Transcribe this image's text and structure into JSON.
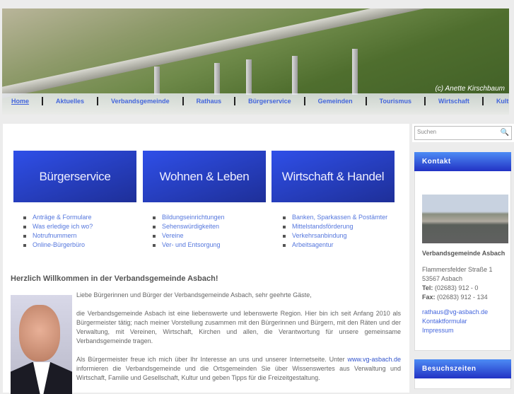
{
  "header": {
    "photo_credit": "(c) Anette Kirschbaum"
  },
  "nav": [
    "Home",
    "Aktuelles",
    "Verbandsgemeinde",
    "Rathaus",
    "Bürgerservice",
    "Gemeinden",
    "Tourismus",
    "Wirtschaft",
    "Kultur und Vereine"
  ],
  "tiles": [
    "Bürgerservice",
    "Wohnen & Leben",
    "Wirtschaft & Handel"
  ],
  "lists": [
    [
      "Anträge & Formulare",
      "Was erledige ich wo?",
      "Notrufnummern",
      "Online-Bürgerbüro"
    ],
    [
      "Bildungseinrichtungen",
      "Sehenswürdigkeiten",
      "Vereine",
      "Ver- und Entsorgung"
    ],
    [
      "Banken, Sparkassen & Postämter",
      "Mittelstandsförderung",
      "Verkehrsanbindung",
      "Arbeitsagentur"
    ]
  ],
  "welcome": {
    "title": "Herzlich Willkommen in der Verbandsgemeinde Asbach!",
    "p1": "Liebe Bürgerinnen und Bürger der Verbandsgemeinde Asbach, sehr geehrte Gäste,",
    "p2": "die Verbandsgemeinde Asbach ist eine liebenswerte und lebenswerte Region. Hier bin ich seit Anfang 2010 als Bürgermeister tätig; nach meiner Vorstellung zusammen mit den Bürgerinnen und Bürgern, mit den Räten und der Verwaltung, mit Vereinen, Wirtschaft, Kirchen und allen, die Verantwortung für unsere gemeinsame Verbandsgemeinde tragen.",
    "p3a": "Als Bürgermeister freue ich mich über Ihr Interesse an uns und unserer Internetseite. Unter ",
    "p3link": "www.vg-asbach.de",
    "p3b": " informieren die Verbandsgemeinde und die Ortsgemeinden Sie über Wissenswertes aus Verwaltung und Wirtschaft, Familie und Gesellschaft, Kultur und geben Tipps für die Freizeitgestaltung."
  },
  "sidebar": {
    "search_placeholder": "Suchen",
    "kontakt_title": "Kontakt",
    "org": "Verbandsgemeinde Asbach",
    "street": "Flammersfelder Straße 1",
    "city": "53567 Asbach",
    "tel_label": "Tel:",
    "tel": " (02683) 912 - 0",
    "fax_label": "Fax:",
    "fax": " (02683) 912 - 134",
    "email": "rathaus@vg-asbach.de",
    "form": "Kontaktformular",
    "impressum": "Impressum",
    "visits_title": "Besuchszeiten"
  }
}
